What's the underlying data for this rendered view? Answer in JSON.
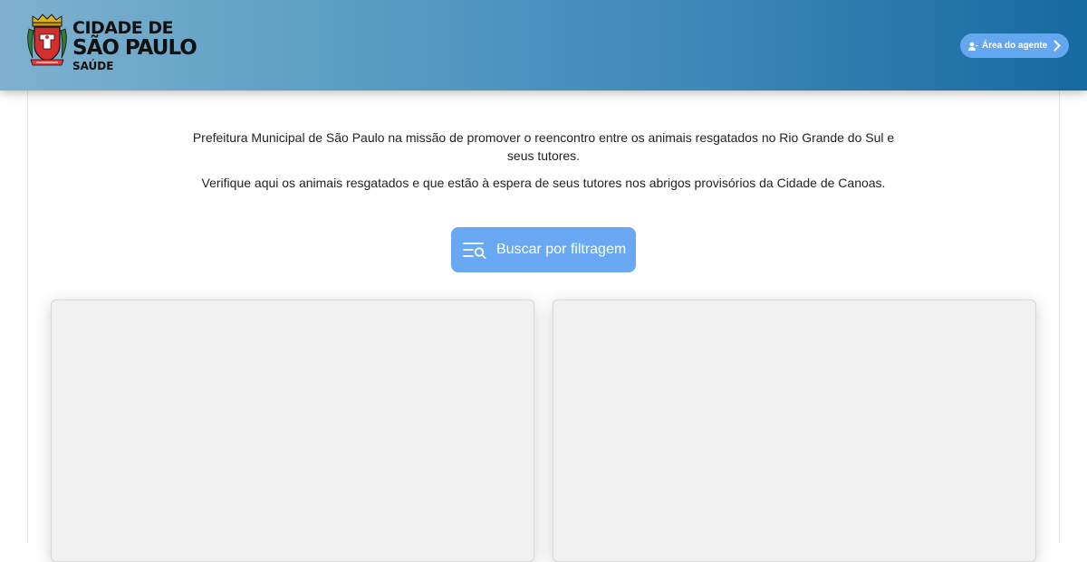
{
  "header": {
    "logo": {
      "line1": "CIDADE DE",
      "line2": "SÃO PAULO",
      "line3": "SAÚDE"
    },
    "agent_button": {
      "label": "Área do agente",
      "icon": "user-icon",
      "chevron": "chevron-right-icon"
    }
  },
  "intro": {
    "paragraph1": "Prefeitura Municipal de São Paulo na missão de promover o reencontro entre os animais resgatados no Rio Grande do Sul e seus tutores.",
    "paragraph2": "Verifique aqui os animais resgatados e que estão à espera de seus tutores nos abrigos provisórios da Cidade de Canoas."
  },
  "filter_button": {
    "label": "Buscar por filtragem",
    "icon": "filter-search-icon"
  },
  "cards": [
    {
      "name": "animal-card-1"
    },
    {
      "name": "animal-card-2"
    }
  ],
  "colors": {
    "header_gradient_start": "#7fb1cf",
    "header_gradient_end": "#16699f",
    "accent_button": "#69a8f3",
    "card_background": "#f1f1f1"
  }
}
